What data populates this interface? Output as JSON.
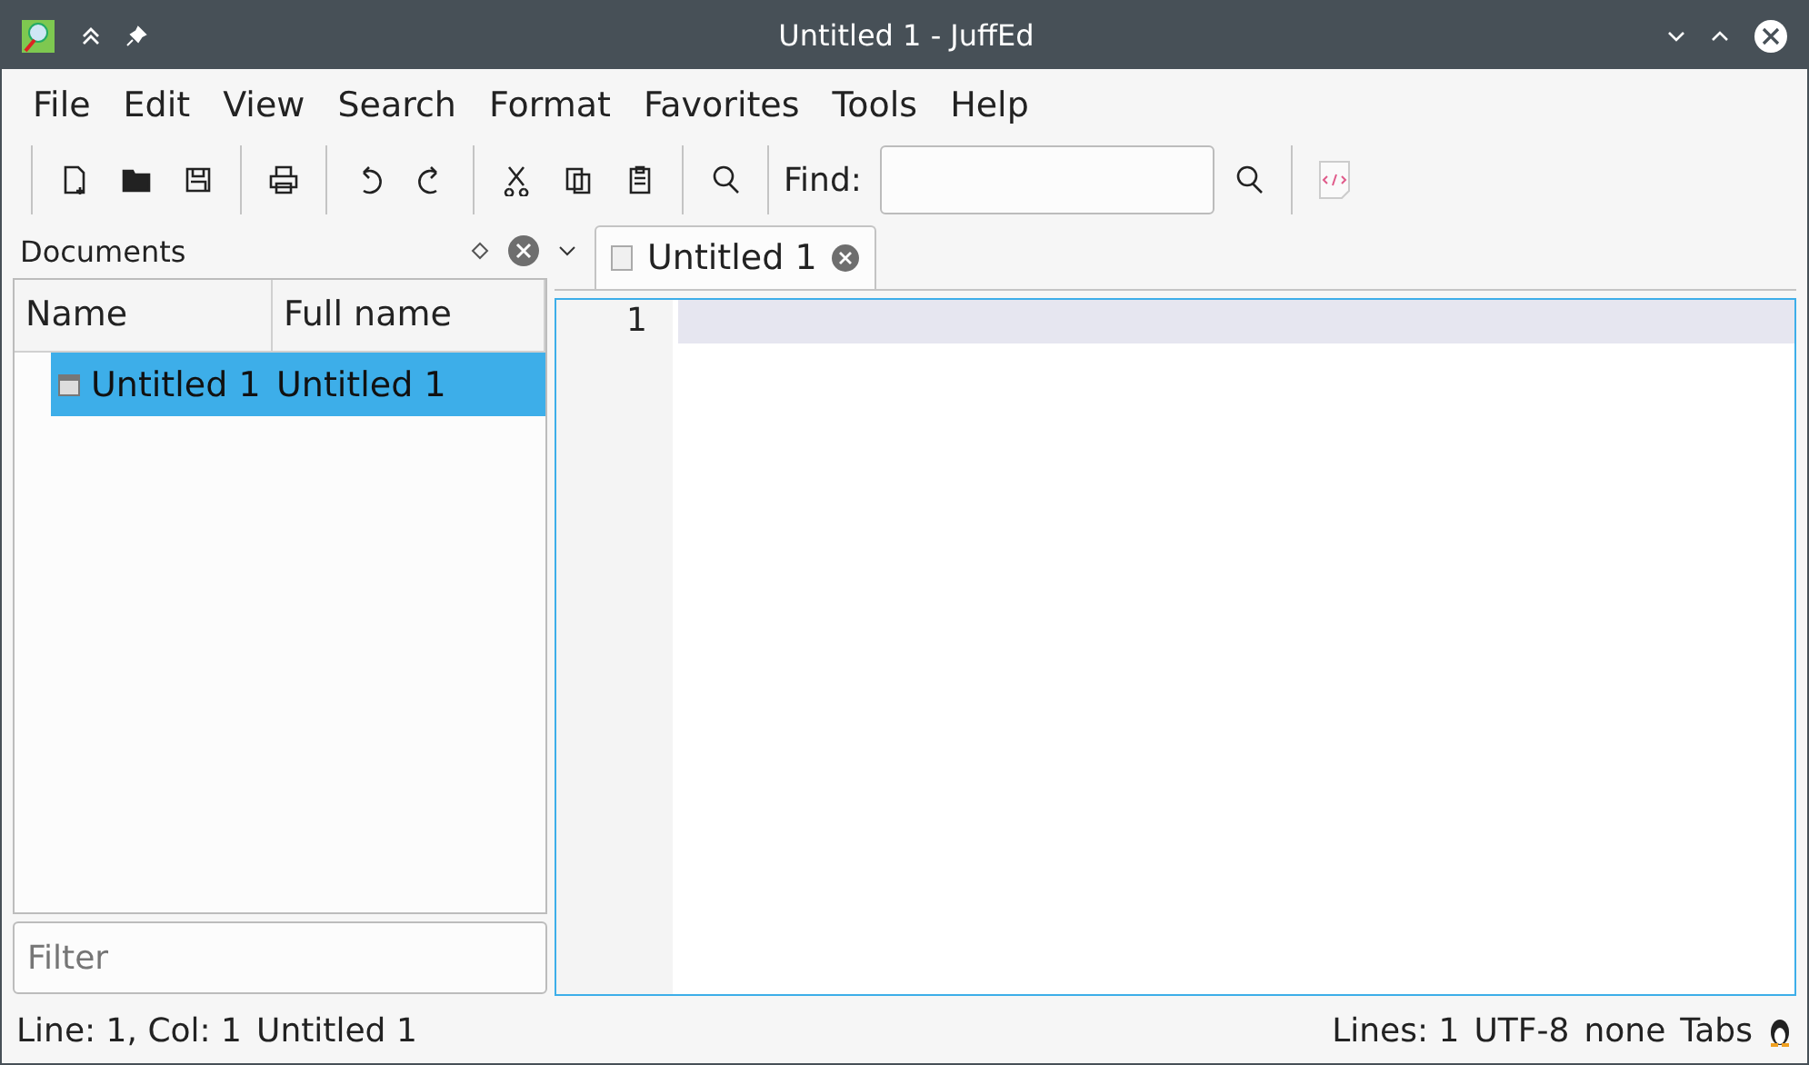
{
  "window": {
    "title": "Untitled 1 - JuffEd"
  },
  "menu": [
    "File",
    "Edit",
    "View",
    "Search",
    "Format",
    "Favorites",
    "Tools",
    "Help"
  ],
  "find": {
    "label": "Find:"
  },
  "documents_panel": {
    "title": "Documents",
    "columns": [
      "Name",
      "Full name"
    ],
    "rows": [
      {
        "name": "Untitled 1",
        "full_name": "Untitled 1",
        "selected": true
      }
    ],
    "filter": {
      "placeholder": "Filter"
    }
  },
  "tabs": [
    {
      "label": "Untitled 1",
      "selected": true
    }
  ],
  "editor": {
    "lines": [
      "1"
    ]
  },
  "status_bar": {
    "left": [
      "Line: 1, Col: 1",
      "Untitled 1"
    ],
    "right": [
      "Lines: 1",
      "UTF-8",
      "none",
      "Tabs"
    ]
  }
}
